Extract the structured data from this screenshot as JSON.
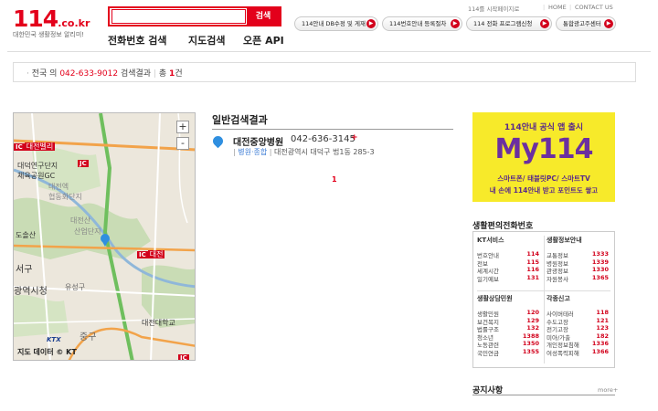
{
  "header": {
    "logo_main": "114",
    "logo_domain": ".co.kr",
    "logo_tagline": "대한민국 생활정보 알리미!",
    "search": {
      "value": "",
      "placeholder": "",
      "button": "검색"
    },
    "nav": [
      "전화번호 검색",
      "지도검색",
      "오픈 API"
    ],
    "top_links": [
      "114를 시작페이지로",
      "HOME",
      "CONTACT US"
    ],
    "service_buttons": [
      "114안내 DB수정 및 게재",
      "114번호안내 등록절차",
      "114 전화 프로그램신청",
      "통합광고주센터"
    ]
  },
  "result_bar": {
    "prefix": "전국 의",
    "number": "042-633-9012",
    "label": "검색결과",
    "divider": "|",
    "count_prefix": "총",
    "count": "1",
    "count_suffix": "건"
  },
  "map": {
    "zoom_in": "+",
    "zoom_out": "-",
    "labels": [
      "대전벨리",
      "대덕연구단지",
      "체육공원GC",
      "대전엑",
      "협동화단지",
      "대전산",
      "산업단지",
      "도솔산",
      "대전",
      "대전대학교",
      "중구",
      "광역시청",
      "유성구",
      "서구"
    ],
    "ic_labels": [
      "IC",
      "JC",
      "IC",
      "IC"
    ],
    "footer": "지도 데이터 © KT",
    "ktx": "KTX"
  },
  "results": {
    "title": "일반검색결과",
    "items": [
      {
        "name": "대전중앙병원",
        "phone": "042-636-3145",
        "plus": "+",
        "category": "병원·종합",
        "address": "대전광역시 대덕구 법1동 285-3"
      }
    ],
    "pages": [
      "1"
    ]
  },
  "ad": {
    "line1": "114안내 공식 앱 출시",
    "line2": "My114",
    "line3": "스마트폰/ 태블릿PC/ 스마트TV",
    "line4": "내 손에 114안내 받고 포인트도 쌓고"
  },
  "directory": {
    "title": "생활편의전화번호",
    "sections": [
      {
        "heading": "KT서비스",
        "rows": [
          [
            "번호안내",
            "114"
          ],
          [
            "전보",
            "115"
          ],
          [
            "세계시간",
            "116"
          ],
          [
            "일기예보",
            "131"
          ]
        ]
      },
      {
        "heading": "생활정보안내",
        "rows": [
          [
            "교통정보",
            "1333"
          ],
          [
            "병원정보",
            "1339"
          ],
          [
            "관광정보",
            "1330"
          ],
          [
            "자원봉사",
            "1365"
          ]
        ]
      },
      {
        "heading": "생활상담민원",
        "rows": [
          [
            "생활민원",
            "120"
          ],
          [
            "보건복지",
            "129"
          ],
          [
            "법률구조",
            "132"
          ],
          [
            "청소년",
            "1388"
          ],
          [
            "노동관련",
            "1350"
          ],
          [
            "국민연금",
            "1355"
          ]
        ]
      },
      {
        "heading": "각종신고",
        "rows": [
          [
            "사이버테러",
            "118"
          ],
          [
            "수도고장",
            "121"
          ],
          [
            "전기고장",
            "123"
          ],
          [
            "미아/가출",
            "182"
          ],
          [
            "개인정보침해",
            "1336"
          ],
          [
            "여성폭력피해",
            "1366"
          ]
        ]
      }
    ]
  },
  "notice": {
    "title": "공지사항",
    "more": "more+"
  },
  "colors": {
    "brand_red": "#e3001b",
    "link_blue": "#3a7bd5",
    "ad_yellow": "#f7ea2a",
    "ad_purple": "#6b2fa0"
  }
}
